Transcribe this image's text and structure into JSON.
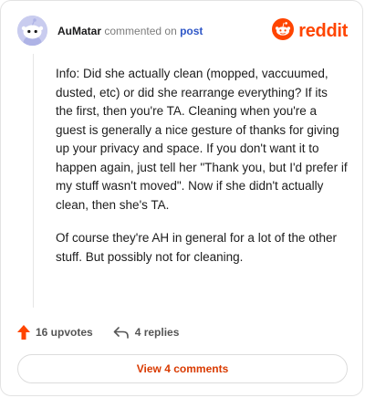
{
  "comment": {
    "author": "AuMatar",
    "action_text": "commented on",
    "target_text": "post",
    "paragraphs": [
      "Info: Did she actually clean (mopped, vaccuumed, dusted, etc) or did she rearrange everything? If its the first, then you're TA. Cleaning when you're a guest is generally a nice gesture of thanks for giving up your privacy and space. If you don't want it to happen again, just tell her \"Thank you, but I'd prefer if my stuff wasn't moved\". Now if she didn't actually clean, then she's TA.",
      "Of course they're AH in general for a lot of the other stuff. But possibly not for cleaning."
    ]
  },
  "brand": {
    "name": "reddit",
    "color": "#ff4500"
  },
  "actions": {
    "upvotes_label": "16 upvotes",
    "replies_label": "4 replies"
  },
  "view_button": {
    "label": "View 4 comments"
  },
  "icons": {
    "avatar": "snoo-avatar-icon",
    "logo": "reddit-logo-icon",
    "upvote": "upvote-arrow-icon",
    "reply": "reply-arrow-icon"
  },
  "colors": {
    "accent": "#ff4500",
    "link": "#2f57c7",
    "button_text": "#d93a00"
  }
}
